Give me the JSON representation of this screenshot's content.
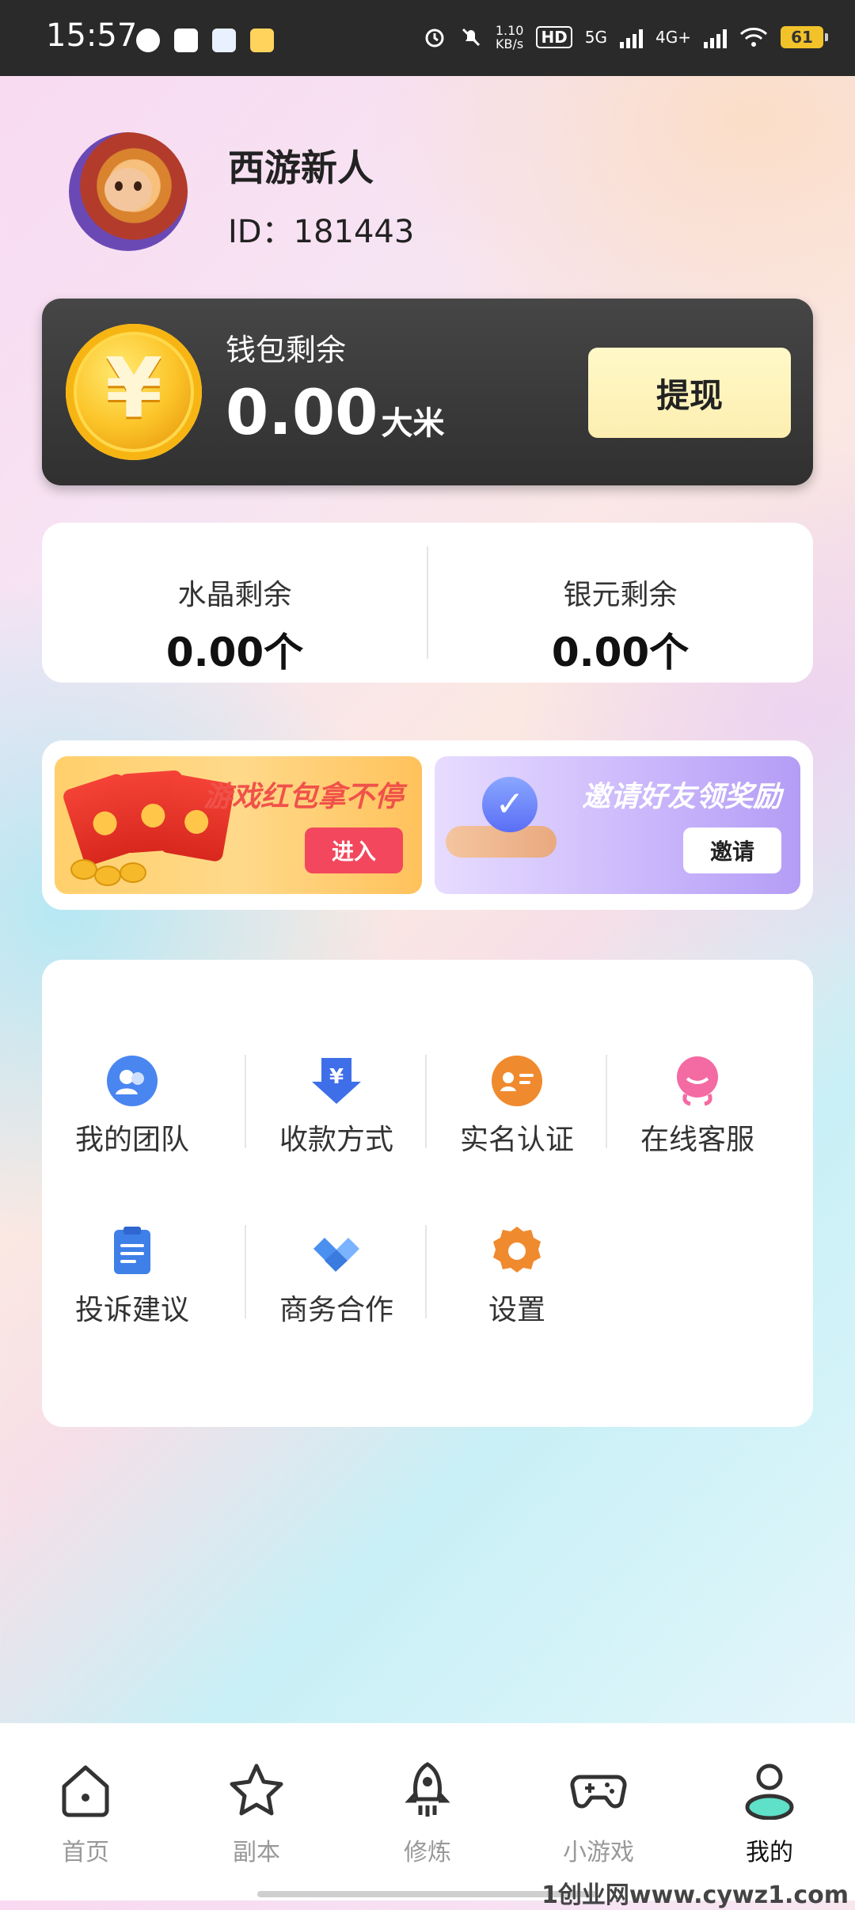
{
  "status_bar": {
    "time": "15:57",
    "net_speed_top": "1.10",
    "net_speed_bottom": "KB/s",
    "hd_label": "HD",
    "sim_5g": "5G",
    "sim_4g": "4G+",
    "battery": "61"
  },
  "profile": {
    "name": "西游新人",
    "id_text": "ID：181443"
  },
  "wallet": {
    "label": "钱包剩余",
    "amount": "0.00",
    "unit": "大米",
    "coin_symbol": "¥",
    "withdraw_label": "提现"
  },
  "balances": [
    {
      "label": "水晶剩余",
      "value": "0.00个"
    },
    {
      "label": "银元剩余",
      "value": "0.00个"
    }
  ],
  "banners": [
    {
      "title": "游戏红包拿不停",
      "button": "进入"
    },
    {
      "title": "邀请好友领奖励",
      "button": "邀请"
    }
  ],
  "menu": [
    {
      "label": "我的团队",
      "icon": "team-icon",
      "color": "#4a86f0"
    },
    {
      "label": "收款方式",
      "icon": "payment-method-icon",
      "color": "#3f6fe8"
    },
    {
      "label": "实名认证",
      "icon": "id-verify-icon",
      "color": "#f08a2e"
    },
    {
      "label": "在线客服",
      "icon": "customer-service-icon",
      "color": "#f46aa3"
    },
    {
      "label": "投诉建议",
      "icon": "feedback-icon",
      "color": "#3f7fe8"
    },
    {
      "label": "商务合作",
      "icon": "handshake-icon",
      "color": "#4a90f0"
    },
    {
      "label": "设置",
      "icon": "gear-icon",
      "color": "#f08a2e"
    }
  ],
  "bottom_nav": [
    {
      "label": "首页",
      "icon": "home-icon",
      "active": false
    },
    {
      "label": "副本",
      "icon": "star-icon",
      "active": false
    },
    {
      "label": "修炼",
      "icon": "rocket-icon",
      "active": false
    },
    {
      "label": "小游戏",
      "icon": "gamepad-icon",
      "active": false
    },
    {
      "label": "我的",
      "icon": "profile-icon",
      "active": true
    }
  ],
  "watermark": "1创业网www.cywz1.com",
  "colors": {
    "wallet_bg": "#3a3a3a",
    "withdraw_bg": "#fdf3bd",
    "accent_teal": "#5fe0c8",
    "banner_red_btn": "#f2475d"
  }
}
